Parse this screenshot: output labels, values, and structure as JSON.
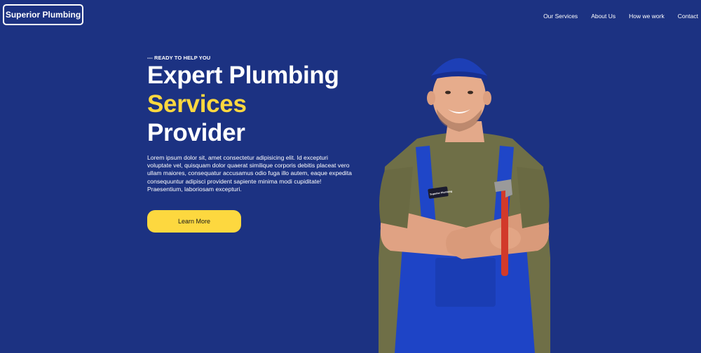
{
  "brand": {
    "name": "Superior Plumbing"
  },
  "nav": {
    "items": [
      {
        "label": "Our Services"
      },
      {
        "label": "About Us"
      },
      {
        "label": "How we work"
      },
      {
        "label": "Contact"
      }
    ]
  },
  "hero": {
    "eyebrow": "--- READY TO HELP YOU",
    "title_line1": "Expert Plumbing",
    "title_line2": "Services",
    "title_line3": "Provider",
    "description": "Lorem ipsum dolor sit, amet consectetur adipisicing elit. Id excepturi voluptate vel, quisquam dolor quaerat similique corporis debitis placeat vero ullam maiores, consequatur accusamus odio fuga illo autem, eaque expedita consequuntur adipisci provident sapiente minima modi cupiditate! Praesentium, laboriosam excepturi.",
    "cta_label": "Learn More",
    "badge_text": "Superior Plumbing"
  },
  "colors": {
    "background": "#1c3282",
    "accent": "#fdd83f",
    "text": "#ffffff"
  },
  "icons": {
    "hero_image": "plumber-photo"
  }
}
